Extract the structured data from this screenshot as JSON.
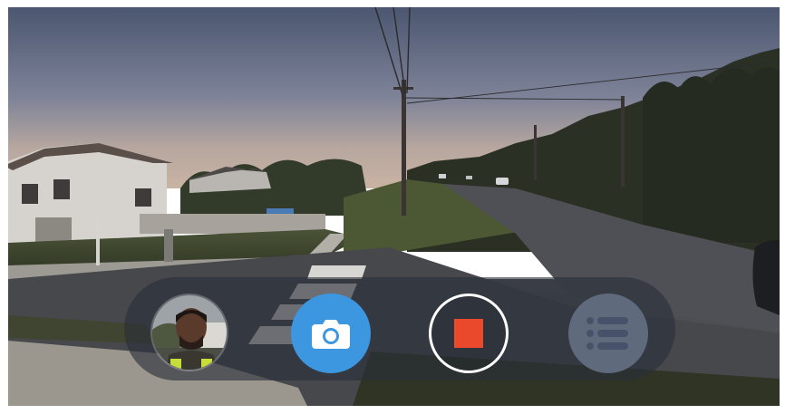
{
  "app": {
    "view": "camera-live-view"
  },
  "controls": {
    "pip_icon": "front-camera-preview",
    "photo_icon": "camera-icon",
    "record_icon": "stop-icon",
    "menu_icon": "list-menu-icon"
  },
  "colors": {
    "bar_background": "#2a2e38",
    "photo_button": "#3d97e0",
    "record_ring": "#ffffff",
    "stop_square": "#ea4a2b",
    "menu_button": "#5f6b7d"
  }
}
